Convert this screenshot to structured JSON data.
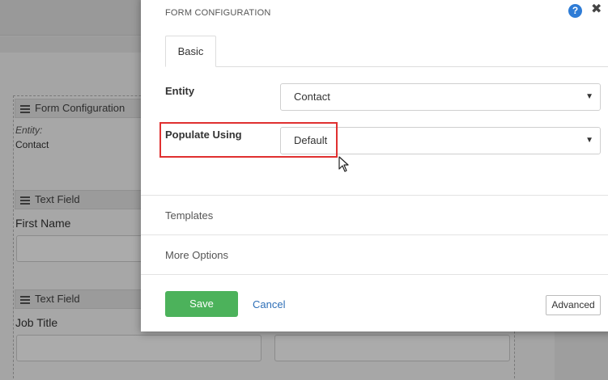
{
  "background": {
    "blocks": [
      {
        "title": "Form Configuration",
        "fields": [
          {
            "label": "Entity:",
            "value": "Contact"
          }
        ]
      },
      {
        "title": "Text Field",
        "label": "First Name"
      },
      {
        "title": "Text Field",
        "label": "Job Title"
      }
    ]
  },
  "modal": {
    "title": "FORM CONFIGURATION",
    "help_icon": "?",
    "close_icon": "✖",
    "tabs": [
      {
        "label": "Basic",
        "active": true
      }
    ],
    "fields": [
      {
        "label": "Entity",
        "value": "Contact"
      },
      {
        "label": "Populate Using",
        "value": "Default"
      }
    ],
    "sections": [
      {
        "label": "Templates"
      },
      {
        "label": "More Options"
      }
    ],
    "footer": {
      "save_label": "Save",
      "cancel_label": "Cancel",
      "advanced_label": "Advanced"
    }
  },
  "colors": {
    "save": "#4cb25b",
    "help": "#2e7cd6",
    "highlight": "#e03030",
    "link": "#2e6fb7"
  }
}
